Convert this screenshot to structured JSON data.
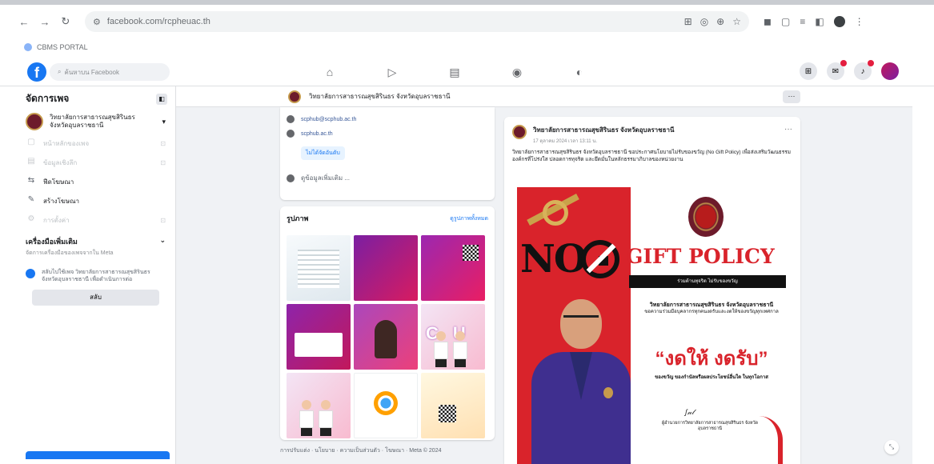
{
  "browser": {
    "url": "facebook.com/rcpheuac.th",
    "bookmark": "CBMS PORTAL"
  },
  "fb": {
    "search_placeholder": "ค้นหาบน Facebook"
  },
  "sidebar": {
    "title": "จัดการเพจ",
    "page_name": "วิทยาลัยการสาธารณสุขสิรินธร จังหวัดอุบลราชธานี",
    "items": [
      {
        "label": "หน้าหลักของเพจ",
        "muted": true
      },
      {
        "label": "ข้อมูลเชิงลึก",
        "muted": true
      },
      {
        "label": "ฟีดโฆษณา",
        "muted": false
      },
      {
        "label": "สร้างโฆษณา",
        "muted": false
      },
      {
        "label": "การตั้งค่า",
        "muted": true
      }
    ],
    "section_title": "เครื่องมือเพิ่มเติม",
    "section_sub": "จัดการเครื่องมือของเพจจากใน Meta",
    "notice_text": "สลับไปใช้เพจ วิทยาลัยการสาธารณสุขสิรินธร จังหวัดอุบลราชธานี เพื่อดำเนินการต่อ",
    "notice_button": "สลับ"
  },
  "page_bar": {
    "name": "วิทยาลัยการสาธารณสุขสิรินธร จังหวัดอุบลราชธานี"
  },
  "intro": {
    "email": "scphub@scphub.ac.th",
    "website": "scphub.ac.th",
    "pill": "ไม่ได้จัดอันดับ",
    "more": "ดูข้อมูลเพิ่มเติม ..."
  },
  "photos": {
    "title": "รูปภาพ",
    "see_all": "ดูรูปภาพทั้งหมด",
    "caption": "การปรับแต่ง · นโยบาย · ความเป็นส่วนตัว · โฆษณา · Meta © 2024"
  },
  "post": {
    "author": "วิทยาลัยการสาธารณสุขสิรินธร จังหวัดอุบลราชธานี",
    "time": "17 ตุลาคม 2024 เวลา 13:11 น.",
    "text": "วิทยาลัยการสาธารณสุขสิรินธร จังหวัดอุบลราชธานี ขอประกาศนโยบายไม่รับของขวัญ (No Gift Policy) เพื่อส่งเสริมวัฒนธรรมองค์กรที่โปร่งใส ปลอดการทุจริต และยึดมั่นในหลักธรรมาภิบาลของหน่วยงาน",
    "poster": {
      "no": "NO",
      "gift": "GIFT POLICY",
      "band": "ร่วมต้านทุจริต ไม่รับของขวัญ",
      "org": "วิทยาลัยการสาธารณสุขสิรินธร จังหวัดอุบลราชธานี",
      "org_desc": "ขอความร่วมมือบุคลากรทุกคนงดรับและงดให้ของขวัญทุกเทศกาล",
      "slogan": "“งดให้ งดรับ”",
      "desc": "ของขวัญ ของกำนัลหรือผลประโยชน์อื่นใด ในทุกโอกาส",
      "sign": "signature",
      "signer": "ผู้อำนวยการวิทยาลัยการสาธารณสุขสิรินธร จังหวัดอุบลราชธานี"
    }
  },
  "colors": {
    "fb_blue": "#1877f2",
    "poster_red": "#d9232b"
  }
}
